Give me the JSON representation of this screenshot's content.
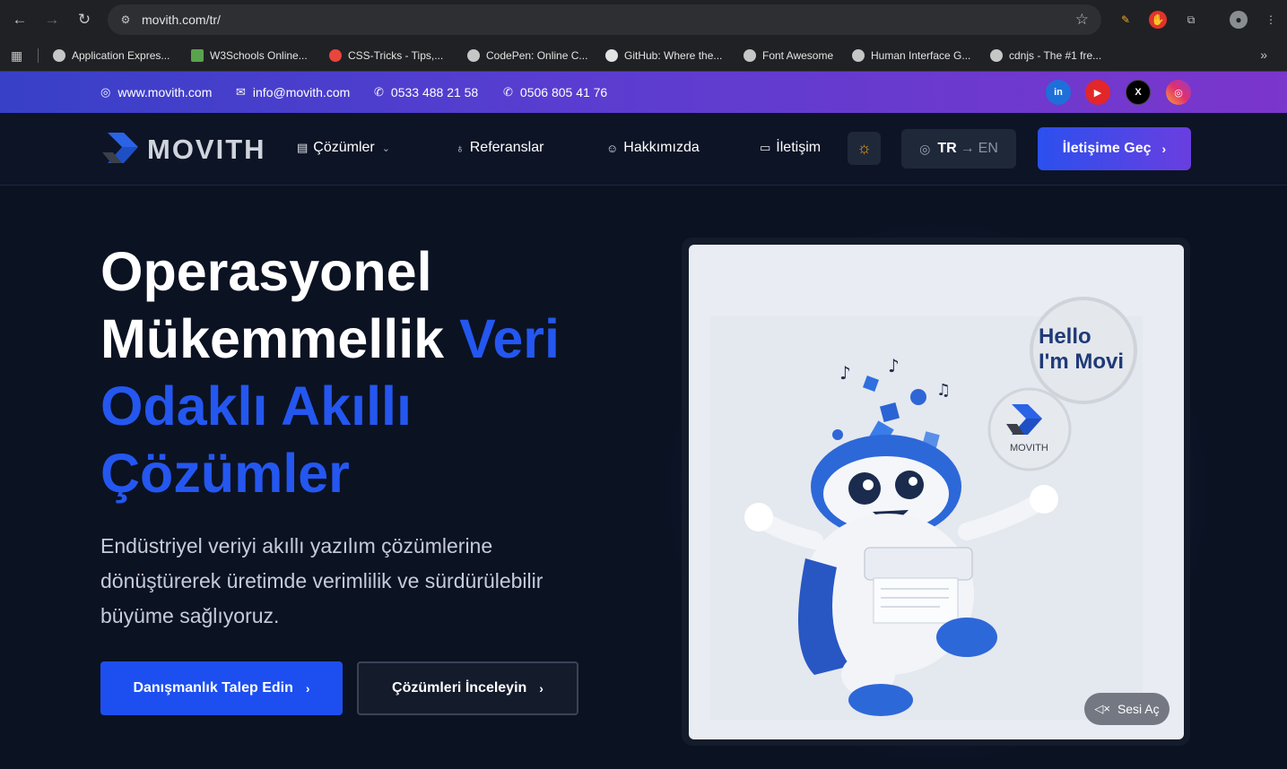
{
  "browser": {
    "url": "movith.com/tr/",
    "bookmarks": [
      {
        "label": "Application Expres..."
      },
      {
        "label": "W3Schools Online..."
      },
      {
        "label": "CSS-Tricks - Tips,..."
      },
      {
        "label": "CodePen: Online C..."
      },
      {
        "label": "GitHub: Where the..."
      },
      {
        "label": "Font Awesome"
      },
      {
        "label": "Human Interface G..."
      },
      {
        "label": "cdnjs - The #1 fre..."
      }
    ],
    "more": "»"
  },
  "topbar": {
    "website": "www.movith.com",
    "email": "info@movith.com",
    "phone1": "0533 488 21 58",
    "phone2": "0506 805 41 76",
    "social": [
      "linkedin-icon",
      "youtube-icon",
      "x-icon",
      "instagram-icon"
    ]
  },
  "nav": {
    "logo_text": "MOVITH",
    "items": [
      {
        "label": "Çözümler"
      },
      {
        "label": "Referanslar"
      },
      {
        "label": "Hakkımızda"
      },
      {
        "label": "İletişim"
      }
    ],
    "lang_current": "TR",
    "lang_arrow": "→",
    "lang_alt": "EN",
    "cta": "İletişime Geç"
  },
  "hero": {
    "title_line1": "Operasyonel",
    "title_line2": "Mükemmellik",
    "title_accent1": "Veri",
    "title_accent2": "Odaklı Akıllı",
    "title_accent3": "Çözümler",
    "description": "Endüstriyel veriyi akıllı yazılım çözümlerine dönüştürerek üretimde verimlilik ve sürdürülebilir büyüme sağlıyoruz.",
    "primary_button": "Danışmanlık Talep Edin",
    "secondary_button": "Çözümleri İnceleyin"
  },
  "media": {
    "bubble_line1": "Hello",
    "bubble_line2": "I'm Movi",
    "badge_text": "MOVITH",
    "sound_button": "Sesi Aç"
  },
  "colors": {
    "accent": "#2457f0",
    "page_bg": "#0b1222",
    "topbar_start": "#3840c8",
    "topbar_end": "#7b36cc"
  }
}
